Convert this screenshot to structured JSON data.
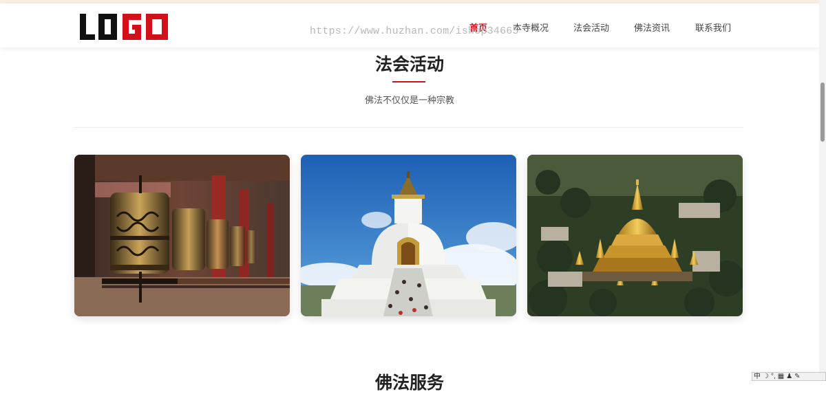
{
  "header": {
    "logo_text": "LOGO",
    "nav": [
      {
        "label": "首页",
        "active": true
      },
      {
        "label": "本寺概况",
        "active": false
      },
      {
        "label": "法会活动",
        "active": false
      },
      {
        "label": "佛法资讯",
        "active": false
      },
      {
        "label": "联系我们",
        "active": false
      }
    ]
  },
  "watermark": "https://www.huzhan.com/ishop34665",
  "section": {
    "title": "法会活动",
    "subtitle": "佛法不仅仅是一种宗教"
  },
  "cards": [
    {
      "icon": "prayer-wheels-photo"
    },
    {
      "icon": "white-stupa-photo"
    },
    {
      "icon": "golden-pagoda-photo"
    }
  ],
  "next_section": {
    "title": "佛法服务"
  },
  "ime_toolbar": {
    "items": [
      "中",
      "☽",
      "°,",
      "▦",
      "♟",
      "✎"
    ]
  },
  "colors": {
    "accent": "#d3101a",
    "logo_black": "#111111"
  }
}
